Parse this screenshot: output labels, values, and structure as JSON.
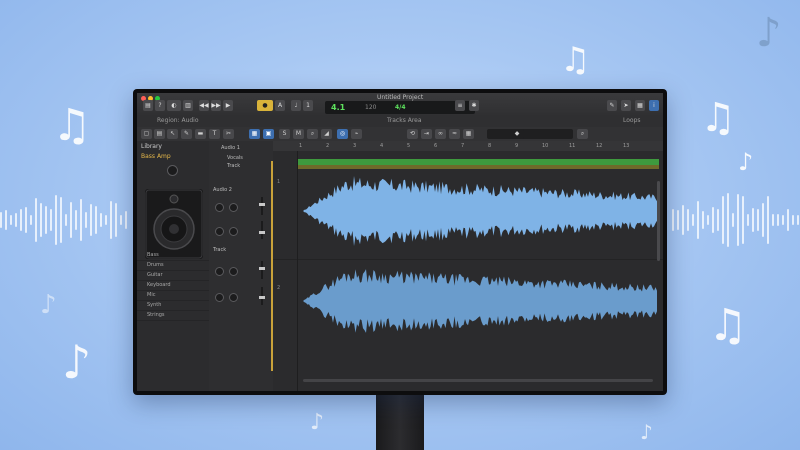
{
  "window": {
    "title": "Untitled Project",
    "lcd_bar": "4.1",
    "lcd_beat": "120",
    "lcd_key": "4/4"
  },
  "subbar": {
    "left_label": "Region: Audio",
    "center_label": "Tracks Area",
    "right_label": "Loops"
  },
  "library": {
    "header": "Library",
    "patch_name": "Bass Amp",
    "items": [
      "Bass",
      "Drums",
      "Guitar",
      "Keyboard",
      "Mic",
      "Synth",
      "Strings"
    ]
  },
  "tracks": {
    "track1_name": "Audio 1",
    "track1_sub": "Vocals",
    "track2_name": "Audio 2",
    "track1_label": "Track",
    "track2_label": "Track"
  },
  "ruler": [
    "1",
    "2",
    "3",
    "4",
    "5",
    "6",
    "7",
    "8",
    "9",
    "10",
    "11",
    "12",
    "13"
  ],
  "colors": {
    "waveform": "#7fb3e6",
    "waveform_dim": "#6a9ccc",
    "region_green": "#3e9a3e",
    "lcd_green": "#5ee35e",
    "selected_tool": "#3d6fb0"
  },
  "icons": [
    "music-note-icon",
    "speaker-icon",
    "play-icon",
    "record-icon",
    "scissors-icon",
    "pencil-icon",
    "settings-icon"
  ]
}
